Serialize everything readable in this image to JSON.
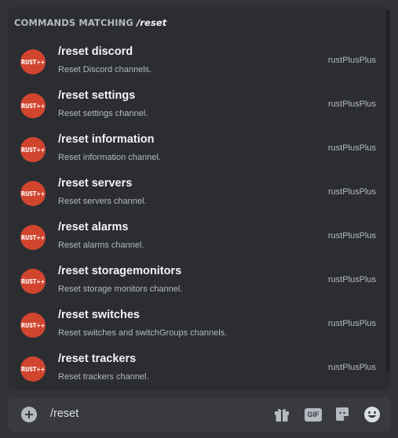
{
  "autocomplete": {
    "header_prefix": "COMMANDS MATCHING",
    "header_query": "/reset",
    "items": [
      {
        "name": "/reset discord",
        "description": "Reset Discord channels.",
        "source": "rustPlusPlus",
        "avatar_text": "RUST++"
      },
      {
        "name": "/reset settings",
        "description": "Reset settings channel.",
        "source": "rustPlusPlus",
        "avatar_text": "RUST++"
      },
      {
        "name": "/reset information",
        "description": "Reset information channel.",
        "source": "rustPlusPlus",
        "avatar_text": "RUST++"
      },
      {
        "name": "/reset servers",
        "description": "Reset servers channel.",
        "source": "rustPlusPlus",
        "avatar_text": "RUST++"
      },
      {
        "name": "/reset alarms",
        "description": "Reset alarms channel.",
        "source": "rustPlusPlus",
        "avatar_text": "RUST++"
      },
      {
        "name": "/reset storagemonitors",
        "description": "Reset storage monitors channel.",
        "source": "rustPlusPlus",
        "avatar_text": "RUST++"
      },
      {
        "name": "/reset switches",
        "description": "Reset switches and switchGroups channels.",
        "source": "rustPlusPlus",
        "avatar_text": "RUST++"
      },
      {
        "name": "/reset trackers",
        "description": "Reset trackers channel.",
        "source": "rustPlusPlus",
        "avatar_text": "RUST++"
      }
    ]
  },
  "composer": {
    "value": "/reset",
    "add_icon": "plus-circle-icon",
    "gift_icon": "gift-icon",
    "gif_label": "GIF",
    "sticker_icon": "sticker-icon",
    "emoji_icon": "emoji-icon"
  },
  "colors": {
    "background": "#313338",
    "panel": "#2b2d31",
    "input": "#383a40",
    "avatar": "#d1452f",
    "text_primary": "#f2f3f5",
    "text_muted": "#b5bac1"
  }
}
